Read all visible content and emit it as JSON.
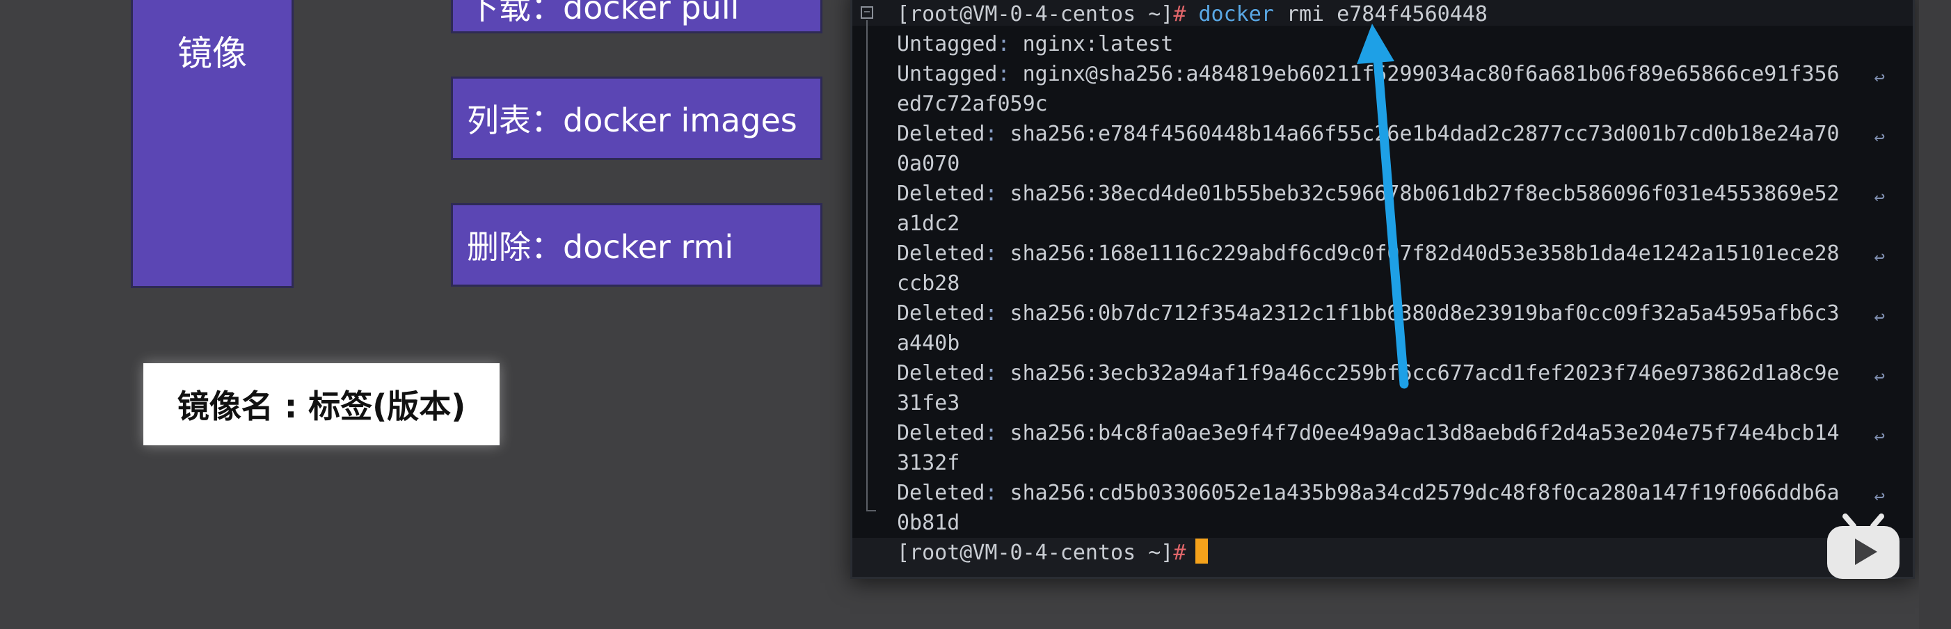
{
  "slide": {
    "mirror_label": "镜像",
    "pull_label": "下载：docker pull",
    "images_label": "列表：docker images",
    "rmi_label": "删除：docker rmi",
    "name_tag": "镜像名 : 标签(版本)"
  },
  "terminal": {
    "command_prompt": "[root@VM-0-4-centos ~]",
    "command_hash": "#",
    "command_name": "docker",
    "command_args": " rmi e784f4560448",
    "lines": [
      {
        "label": "Untagged",
        "value": " nginx:latest",
        "wrap": false
      },
      {
        "label": "Untagged",
        "value": " nginx@sha256:a484819eb60211f5299034ac80f6a681b06f89e65866ce91f356",
        "wrap": true
      },
      {
        "label": "",
        "value": "ed7c72af059c",
        "wrap": false
      },
      {
        "label": "Deleted",
        "value": " sha256:e784f4560448b14a66f55c26e1b4dad2c2877cc73d001b7cd0b18e24a70",
        "wrap": true
      },
      {
        "label": "",
        "value": "0a070",
        "wrap": false
      },
      {
        "label": "Deleted",
        "value": " sha256:38ecd4de01b55beb32c596678b061db27f8ecb586096f031e4553869e52",
        "wrap": true
      },
      {
        "label": "",
        "value": "a1dc2",
        "wrap": false
      },
      {
        "label": "Deleted",
        "value": " sha256:168e1116c229abdf6cd9c0f07f82d40d53e358b1da4e1242a15101ece28",
        "wrap": true
      },
      {
        "label": "",
        "value": "ccb28",
        "wrap": false
      },
      {
        "label": "Deleted",
        "value": " sha256:0b7dc712f354a2312c1f1bb6380d8e23919baf0cc09f32a5a4595afb6c3",
        "wrap": true
      },
      {
        "label": "",
        "value": "a440b",
        "wrap": false
      },
      {
        "label": "Deleted",
        "value": " sha256:3ecb32a94af1f9a46cc259bf6cc677acd1fef2023f746e973862d1a8c9e",
        "wrap": true
      },
      {
        "label": "",
        "value": "31fe3",
        "wrap": false
      },
      {
        "label": "Deleted",
        "value": " sha256:b4c8fa0ae3e9f4f7d0ee49a9ac13d8aebd6f2d4a53e204e75f74e4bcb14",
        "wrap": true
      },
      {
        "label": "",
        "value": "3132f",
        "wrap": false
      },
      {
        "label": "Deleted",
        "value": " sha256:cd5b03306052e1a435b98a34cd2579dc48f8f0ca280a147f19f066ddb6a",
        "wrap": true
      },
      {
        "label": "",
        "value": "0b81d",
        "wrap": false
      }
    ],
    "final_prompt": "[root@VM-0-4-centos ~]",
    "final_hash": "#",
    "wrap_glyph": "↩"
  },
  "colors": {
    "slide_box": "#5b46b4",
    "cmd_highlight": "#5aa9e6",
    "hash": "#e0666a",
    "cursor": "#f5a21b",
    "arrow": "#1ea0e6"
  },
  "icons": {
    "fold": "fold-toggle-icon",
    "wrap": "line-wrap-icon",
    "arrow": "annotation-arrow",
    "logo": "bilibili-tv-icon"
  }
}
